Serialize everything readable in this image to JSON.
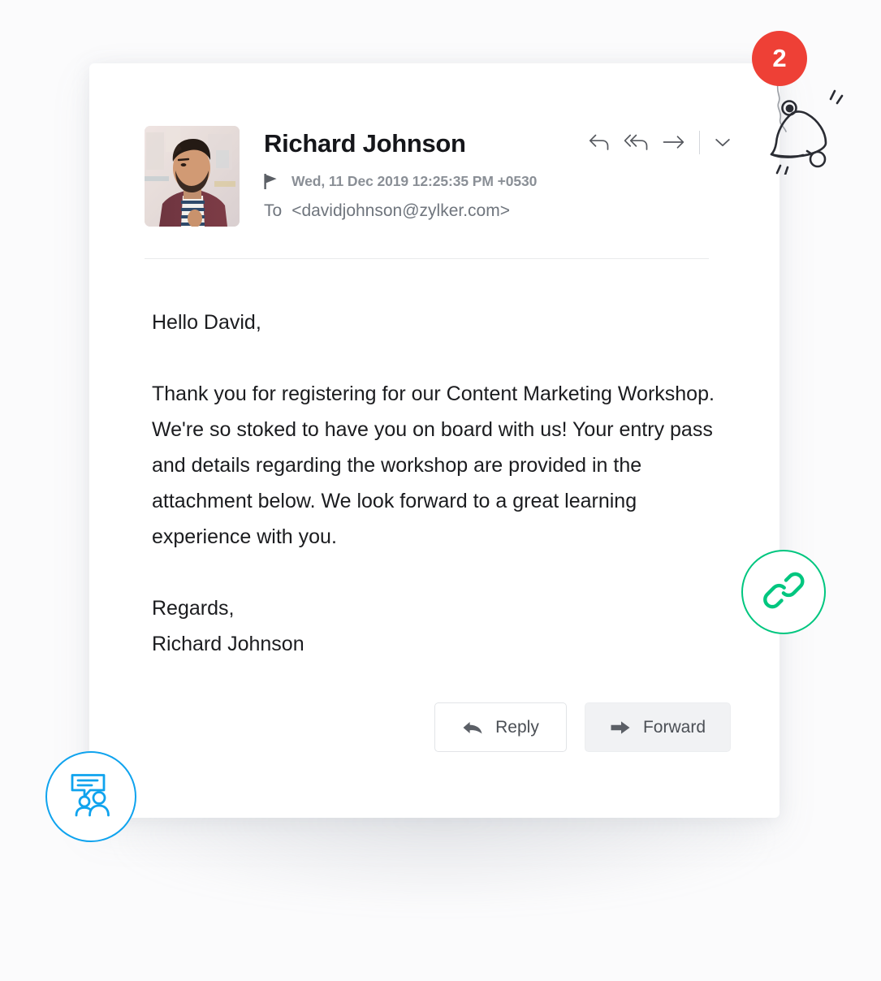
{
  "background": {
    "color": "#fbfbfc"
  },
  "email": {
    "sender": {
      "name": "Richard Johnson",
      "avatar_alt": "Richard Johnson portrait"
    },
    "flag_icon": "flag-icon",
    "date": "Wed, 11 Dec 2019 12:25:35 PM +0530",
    "to_label": "To",
    "to_address": "<davidjohnson@zylker.com>",
    "header_actions": [
      {
        "name": "reply-icon",
        "label": "Reply"
      },
      {
        "name": "reply-all-icon",
        "label": "Reply All"
      },
      {
        "name": "forward-icon",
        "label": "Forward"
      },
      {
        "name": "chevron-down-icon",
        "label": "More options"
      }
    ],
    "body": {
      "greeting": "Hello David,",
      "paragraph": "Thank you for registering for our Content Marketing Workshop. We're so stoked to have you on board with us! Your entry pass and details regarding the workshop are provided in the attachment below. We look forward to a great learning experience with you.",
      "signoff": "Regards,",
      "signature_name": "Richard Johnson"
    },
    "footer": {
      "reply_label": "Reply",
      "forward_label": "Forward"
    }
  },
  "notification": {
    "count": "2",
    "badge_color": "#ee4036",
    "bell_icon": "bell-icon"
  },
  "floating": {
    "link": {
      "icon": "link-icon",
      "color": "#00c67f"
    },
    "chat": {
      "icon": "group-chat-icon",
      "color": "#0fa3ee"
    }
  }
}
